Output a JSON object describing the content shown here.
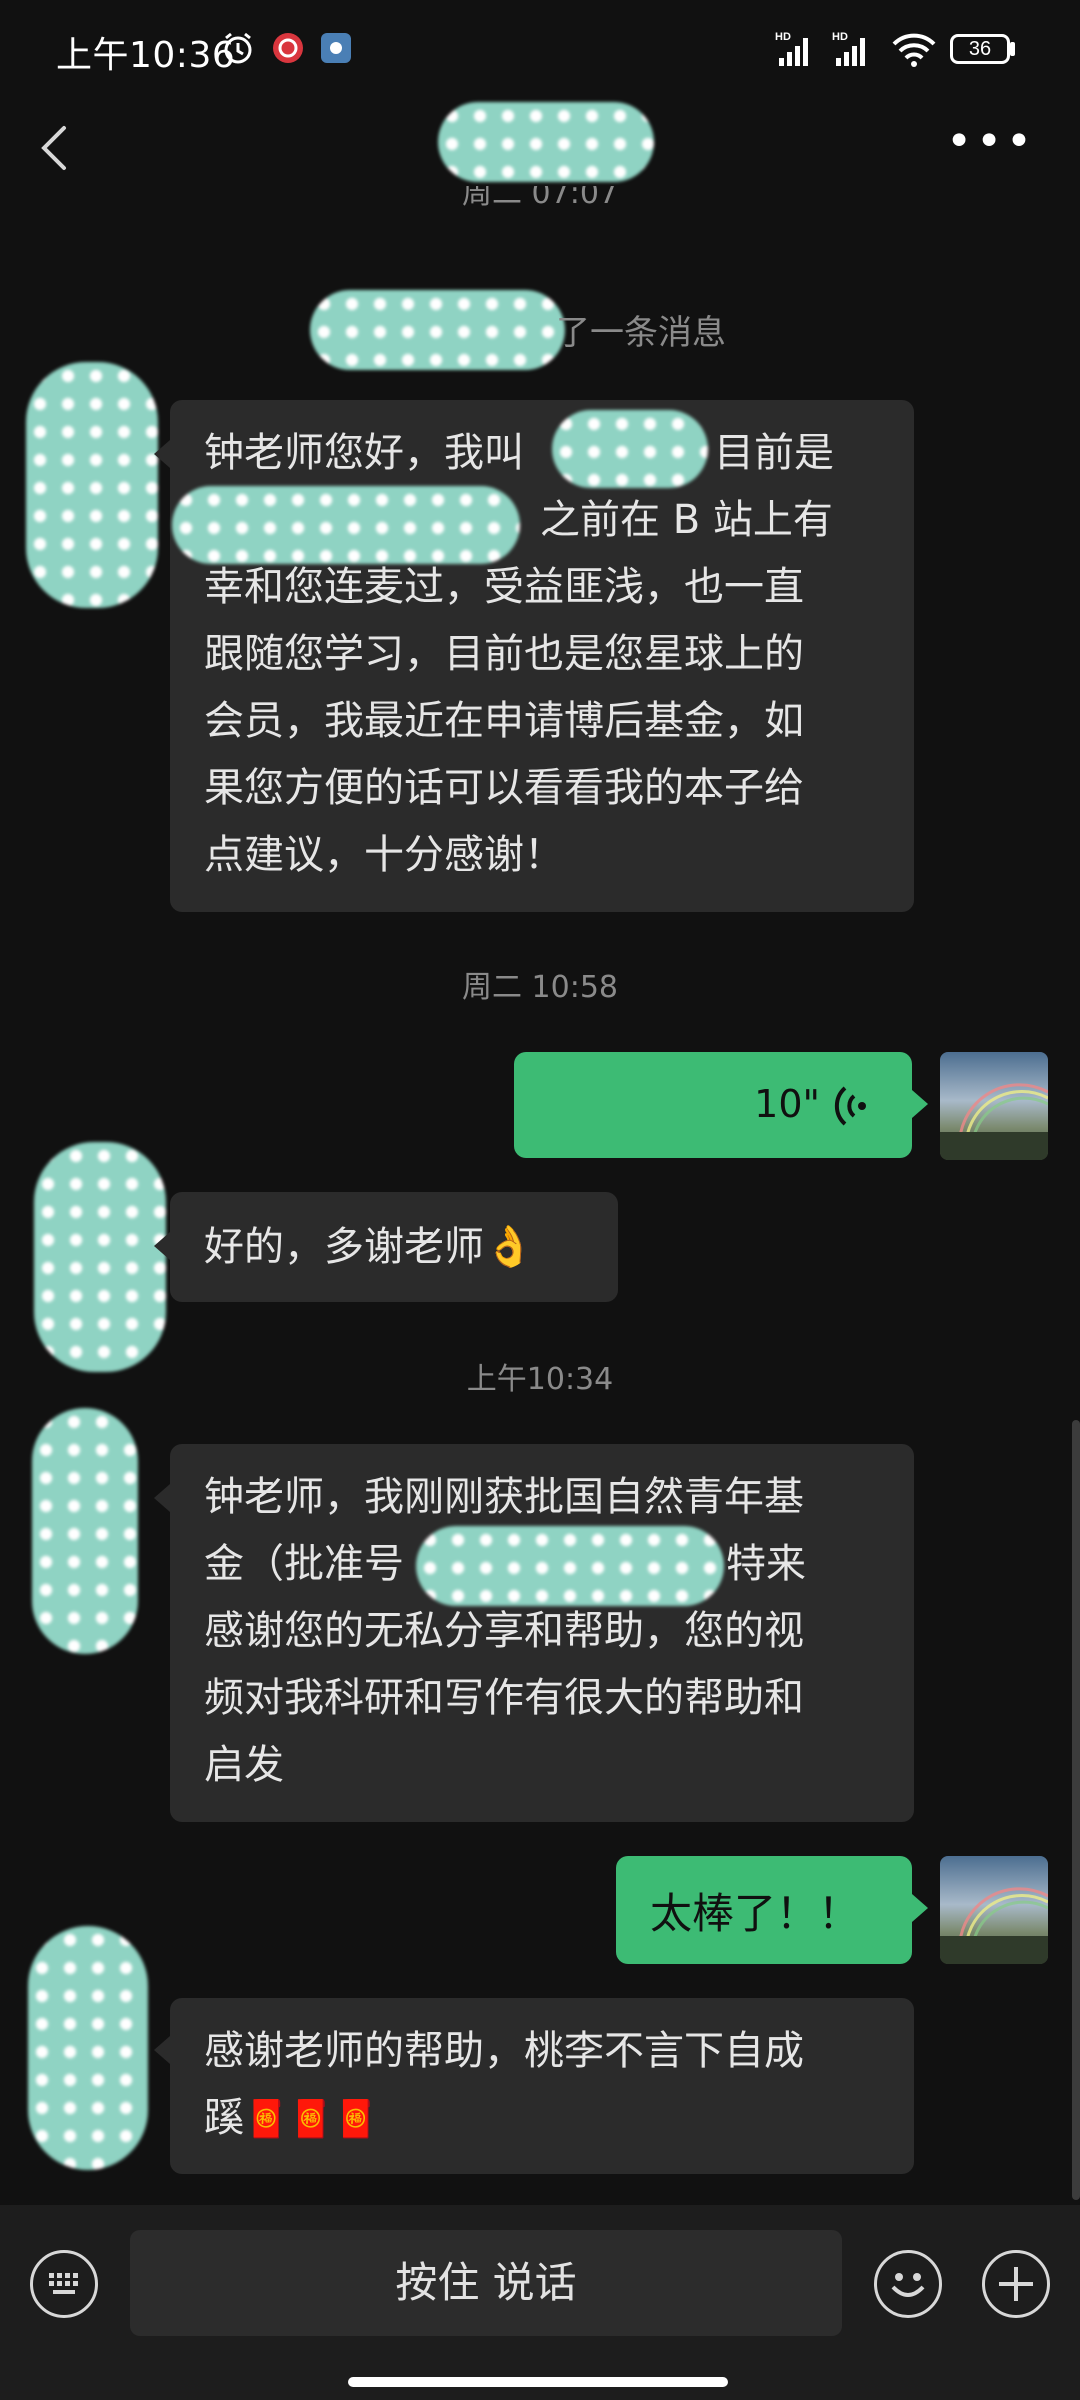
{
  "status_bar": {
    "time": "上午10:36",
    "battery": "36",
    "signal_1": "HD",
    "signal_2": "HD"
  },
  "nav": {
    "more_label": "•••"
  },
  "chat": {
    "top_partial_timestamp": "周二 07:07",
    "system_notice": "了一条消息",
    "messages": [
      {
        "text_lines": [
          "钟老师您好，我叫",
          "，目前是",
          "之前在 B 站上有",
          "幸和您连麦过，受益匪浅，也一直",
          "跟随您学习，目前也是您星球上的",
          "会员，我最近在申请博后基金，如",
          "果您方便的话可以看看我的本子给",
          "点建议，十分感谢！"
        ]
      },
      {
        "timestamp": "周二 10:58"
      },
      {
        "voice_duration": "10\""
      },
      {
        "text": "好的，多谢老师👌"
      },
      {
        "timestamp": "上午10:34"
      },
      {
        "text_lines": [
          "钟老师，我刚刚获批国自然青年基",
          "金（批准号",
          "，特来",
          "感谢您的无私分享和帮助，您的视",
          "频对我科研和写作有很大的帮助和",
          "启发"
        ]
      },
      {
        "text": "太棒了！！"
      },
      {
        "text_lines": [
          "感谢老师的帮助，桃李不言下自成",
          "蹊"
        ],
        "emoji": "🧧🧧🧧"
      }
    ]
  },
  "input_bar": {
    "talk_label": "按住 说话"
  },
  "colors": {
    "background": "#111111",
    "bubble_other": "#2b2b2b",
    "bubble_me": "#3dbb74"
  },
  "icons": [
    "back-icon",
    "more-icon",
    "voice-wave-icon",
    "keyboard-icon",
    "emoji-icon",
    "plus-icon"
  ]
}
